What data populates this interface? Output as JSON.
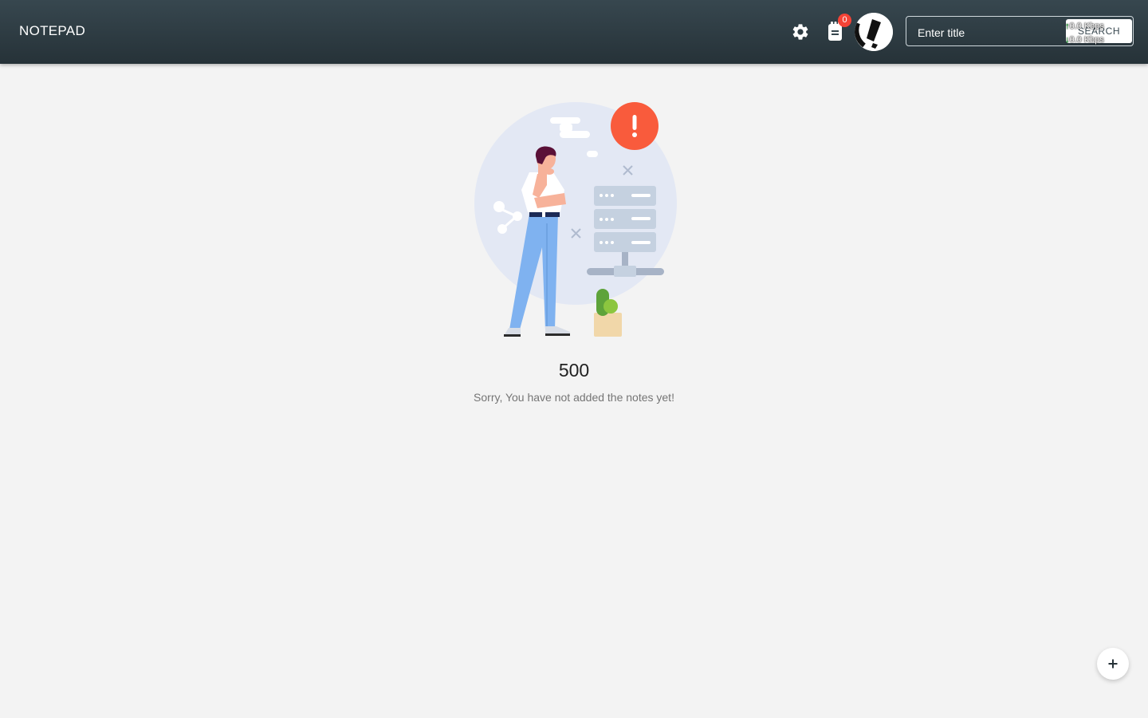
{
  "navbar": {
    "brand": "NOTEPAD",
    "notes_badge_count": "0",
    "search": {
      "placeholder": "Enter title",
      "button_label": "SEARCH"
    }
  },
  "overlay": {
    "upload_speed": "0.0 Kbps",
    "download_speed": "0.0 Kbps"
  },
  "empty_state": {
    "code": "500",
    "message": "Sorry, You have not added the notes yet!"
  },
  "icons": {
    "settings": "gear-icon",
    "notes": "clipboard-icon",
    "avatar": "avatar",
    "fab": "plus-icon"
  },
  "colors": {
    "navbar": "#37474f",
    "badge": "#f44336",
    "alert": "#f95b3c",
    "page_background": "#f3f3f3"
  }
}
